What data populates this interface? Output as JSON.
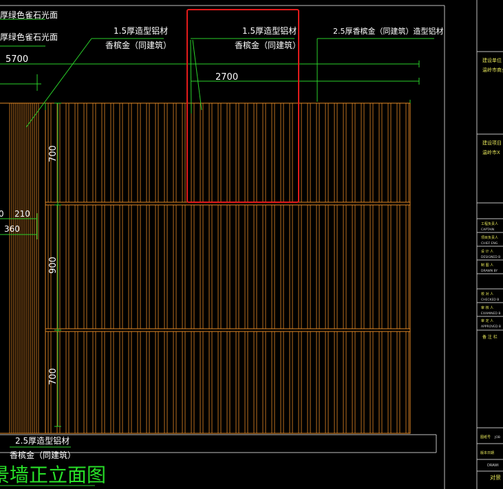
{
  "colors": {
    "background": "#000000",
    "wood": "#e58a26",
    "dimension": "#2ad12a",
    "highlight": "#e21b1b",
    "border": "#bfbfbf",
    "text": "#ffffff",
    "title": "#28e028"
  },
  "left_labels": [
    "厚绿色雀石光面",
    "厚绿色雀石光面"
  ],
  "callouts": [
    {
      "line1": "1.5厚造型铝材",
      "line2": "香槟金（同建筑）"
    },
    {
      "line1": "1.5厚造型铝材",
      "line2": "香槟金（同建筑）"
    },
    {
      "line1": "2.5厚香槟金（同建筑）造型铝材",
      "line2": ""
    }
  ],
  "bottom_callout": {
    "line1": "2.5厚造型铝材",
    "line2": "香槟金（同建筑）"
  },
  "dimensions": {
    "overall": "5700",
    "span": "2700",
    "upper_panel": "700",
    "middle_panel": "900",
    "lower_panel": "700",
    "side_a": "0",
    "side_b": "210",
    "side_c": "360"
  },
  "drawing_title": "景墙正立面图",
  "title_block": {
    "rows": [
      "建设单位",
      "温岭市商业",
      "建设项目",
      "温岭市X（",
      "工程负责人",
      "CAPTAIN",
      "项目负责人",
      "CHIEF ENG",
      "设 计 人",
      "DESIGNED B",
      "制 图 人",
      "DRAWN BY",
      "校 对 人",
      "CHECKED B",
      "审 核 人",
      "EXAMINED B",
      "审 定 人",
      "APPROVED B",
      "备 注 栏"
    ],
    "bottom_rows": [
      "图纸号",
      "JOB",
      "版本日期",
      "DRAWI",
      "对景"
    ]
  }
}
